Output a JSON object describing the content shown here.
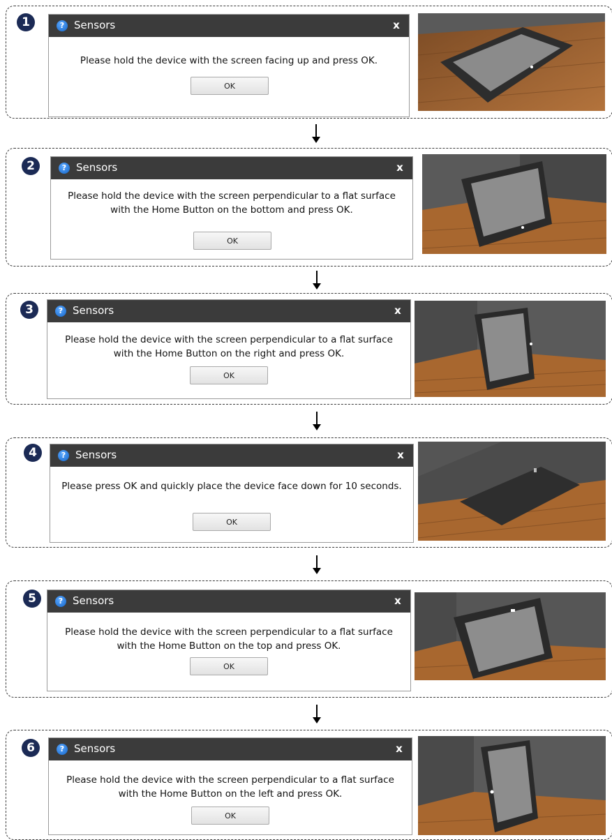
{
  "steps": [
    {
      "number": "1",
      "title": "Sensors",
      "close": "x",
      "message": "Please hold the device with the screen facing up and press OK.",
      "ok": "OK"
    },
    {
      "number": "2",
      "title": "Sensors",
      "close": "x",
      "message": "Please hold the device with the screen perpendicular to a flat surface with the Home Button on the bottom and press OK.",
      "ok": "OK"
    },
    {
      "number": "3",
      "title": "Sensors",
      "close": "x",
      "message": "Please hold the device with the screen perpendicular to a flat surface with the Home Button on the right and press OK.",
      "ok": "OK"
    },
    {
      "number": "4",
      "title": "Sensors",
      "close": "x",
      "message": "Please press OK and quickly place the device face down for 10 seconds.",
      "ok": "OK"
    },
    {
      "number": "5",
      "title": "Sensors",
      "close": "x",
      "message": "Please hold the device with the screen perpendicular to a flat surface with the Home Button on the top and press OK.",
      "ok": "OK"
    },
    {
      "number": "6",
      "title": "Sensors",
      "close": "x",
      "message": "Please hold the device with the screen perpendicular to a flat surface with the Home Button on the left and press OK.",
      "ok": "OK"
    }
  ],
  "colors": {
    "titlebar": "#3b3b3b",
    "badge": "#1b2a55",
    "help_icon": "#1565c8"
  },
  "icons": {
    "help": "question-mark-icon",
    "close": "close-icon",
    "arrow": "arrow-down-icon"
  }
}
